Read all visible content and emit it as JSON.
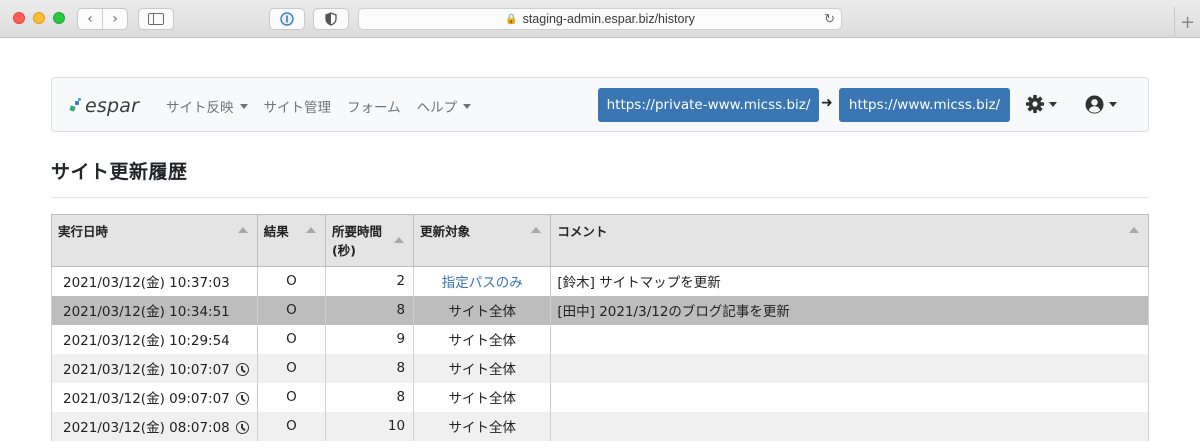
{
  "browser": {
    "url_text": "staging-admin.espar.biz/history"
  },
  "app": {
    "logo_text": "espar",
    "menu": [
      {
        "label": "サイト反映",
        "has_dropdown": true
      },
      {
        "label": "サイト管理",
        "has_dropdown": false
      },
      {
        "label": "フォーム",
        "has_dropdown": false
      },
      {
        "label": "ヘルプ",
        "has_dropdown": true
      }
    ],
    "source_url": "https://private-www.micss.biz/",
    "target_url": "https://www.micss.biz/",
    "arrow": "➜",
    "accent_color": "#3a76b4"
  },
  "page": {
    "title": "サイト更新履歴"
  },
  "table": {
    "headers": {
      "date": "実行日時",
      "result": "結果",
      "duration_line1": "所要時間",
      "duration_line2": "(秒)",
      "target": "更新対象",
      "comment": "コメント"
    },
    "rows": [
      {
        "date": "2021/03/12(金) 10:37:03",
        "result": "O",
        "duration": "2",
        "target": "指定パスのみ",
        "comment": "[鈴木] サイトマップを更新"
      },
      {
        "date": "2021/03/12(金) 10:34:51",
        "result": "O",
        "duration": "8",
        "target": "サイト全体",
        "comment": "[田中] 2021/3/12のブログ記事を更新"
      },
      {
        "date": "2021/03/12(金) 10:29:54",
        "result": "O",
        "duration": "9",
        "target": "サイト全体",
        "comment": ""
      },
      {
        "date": "2021/03/12(金) 10:07:07",
        "result": "O",
        "duration": "8",
        "target": "サイト全体",
        "comment": ""
      },
      {
        "date": "2021/03/12(金) 09:07:07",
        "result": "O",
        "duration": "8",
        "target": "サイト全体",
        "comment": ""
      },
      {
        "date": "2021/03/12(金) 08:07:08",
        "result": "O",
        "duration": "10",
        "target": "サイト全体",
        "comment": ""
      }
    ]
  }
}
